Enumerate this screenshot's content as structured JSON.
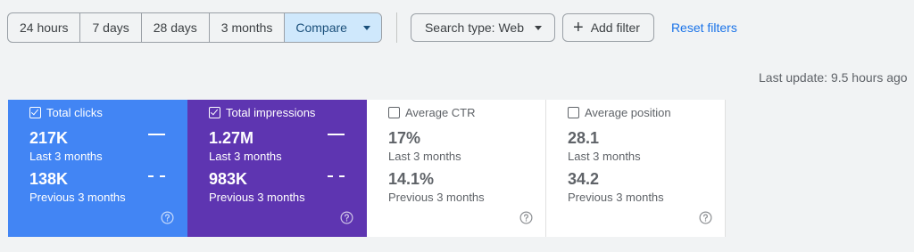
{
  "toolbar": {
    "ranges": [
      "24 hours",
      "7 days",
      "28 days",
      "3 months"
    ],
    "compare_label": "Compare",
    "search_type_label": "Search type: Web",
    "add_filter_label": "Add filter",
    "reset_label": "Reset filters"
  },
  "last_update": "Last update: 9.5 hours ago",
  "metrics": [
    {
      "name": "Total clicks",
      "checked": true,
      "current_value": "217K",
      "current_label": "Last 3 months",
      "previous_value": "138K",
      "previous_label": "Previous 3 months",
      "color": "#4285f4"
    },
    {
      "name": "Total impressions",
      "checked": true,
      "current_value": "1.27M",
      "current_label": "Last 3 months",
      "previous_value": "983K",
      "previous_label": "Previous 3 months",
      "color": "#5e35b1"
    },
    {
      "name": "Average CTR",
      "checked": false,
      "current_value": "17%",
      "current_label": "Last 3 months",
      "previous_value": "14.1%",
      "previous_label": "Previous 3 months",
      "color": "#ffffff"
    },
    {
      "name": "Average position",
      "checked": false,
      "current_value": "28.1",
      "current_label": "Last 3 months",
      "previous_value": "34.2",
      "previous_label": "Previous 3 months",
      "color": "#ffffff"
    }
  ],
  "colors": {
    "accent": "#1a73e8",
    "compare_bg": "#cfe8fc",
    "page_bg": "#f1f3f4"
  }
}
